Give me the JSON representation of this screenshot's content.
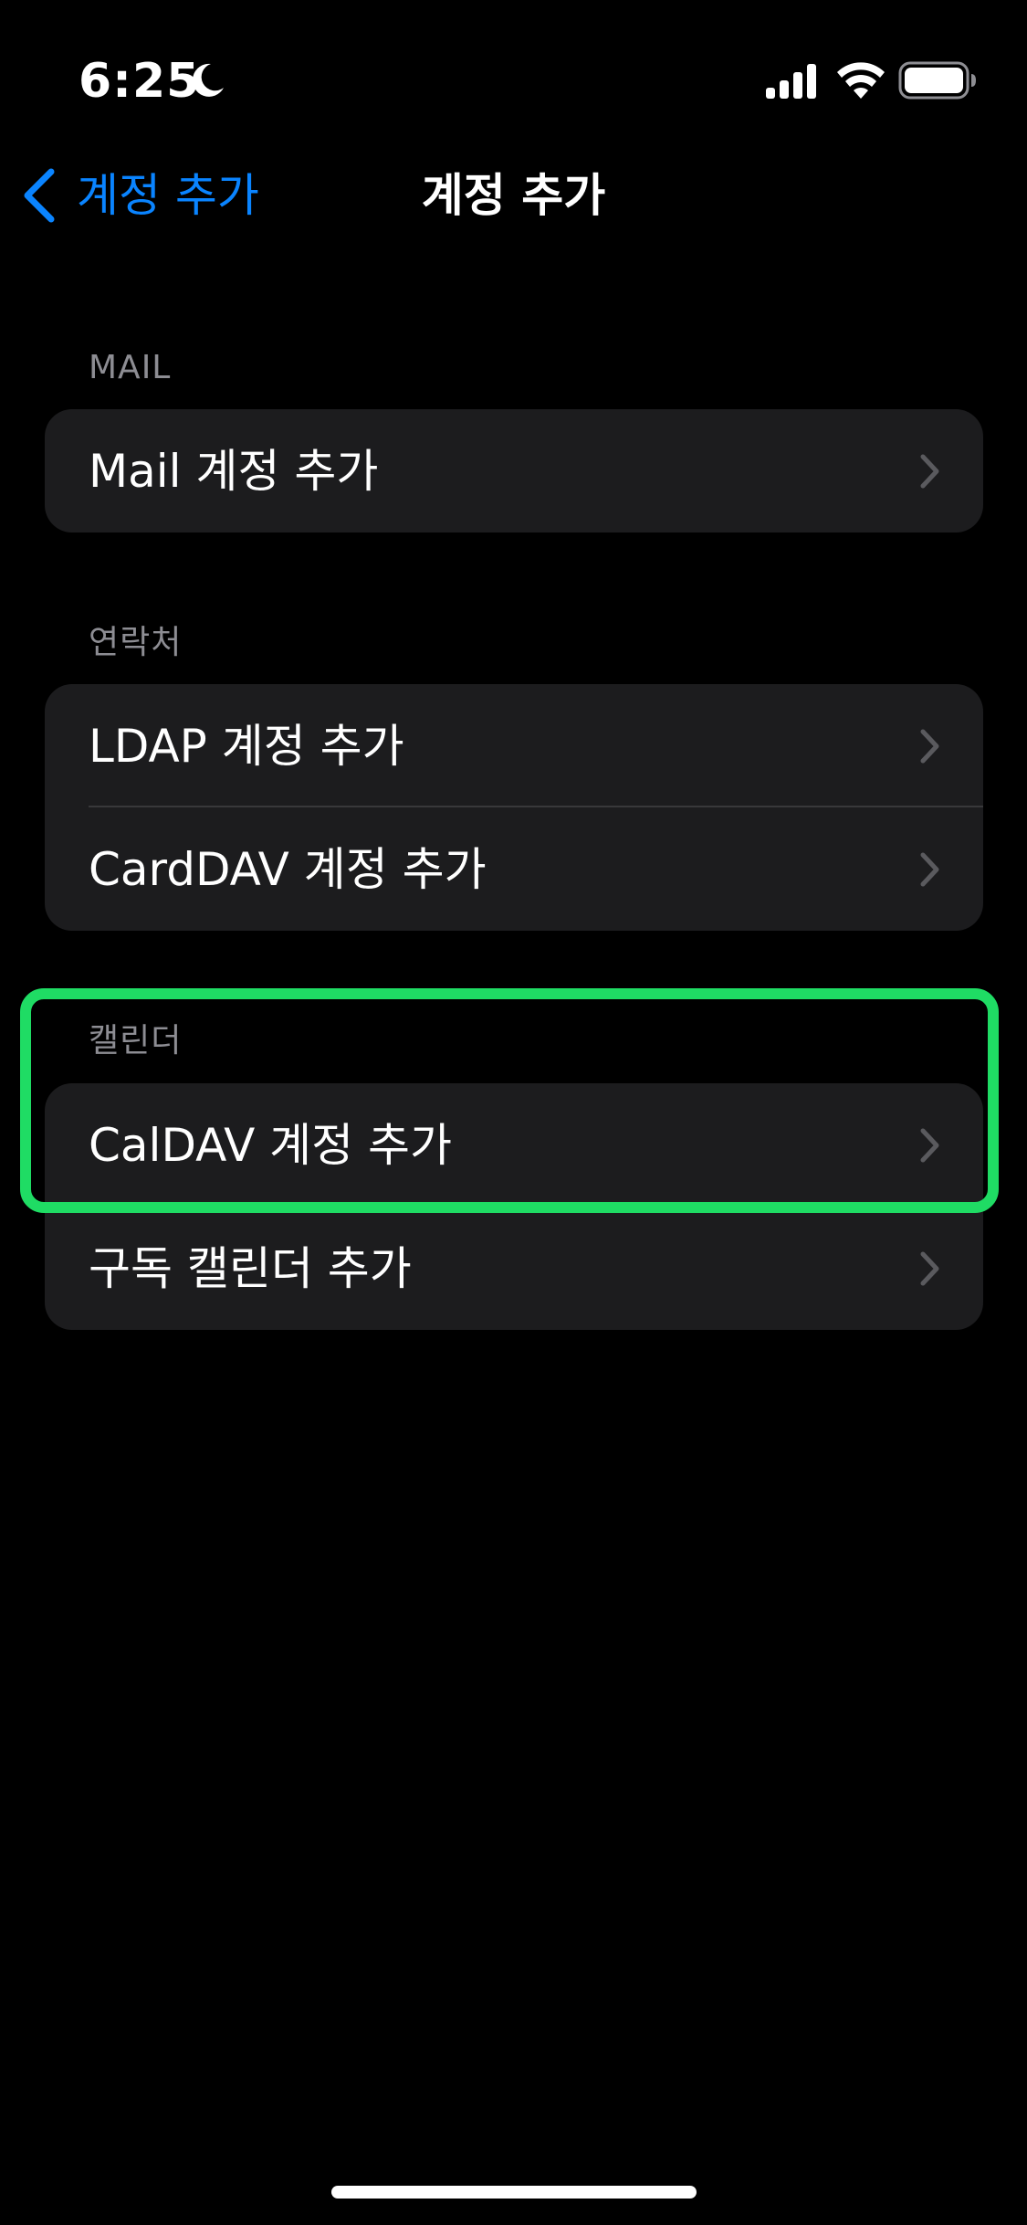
{
  "status_bar": {
    "time": "6:25",
    "icons": [
      "moon-icon",
      "cellular-signal-icon",
      "wifi-icon",
      "battery-icon"
    ]
  },
  "nav": {
    "back_label": "계정 추가",
    "title": "계정 추가"
  },
  "sections": {
    "mail": {
      "header": "MAIL",
      "rows": [
        "Mail 계정 추가"
      ]
    },
    "contacts": {
      "header": "연락처",
      "rows": [
        "LDAP 계정 추가",
        "CardDAV 계정 추가"
      ]
    },
    "calendar": {
      "header": "캘린더",
      "rows": [
        "CalDAV 계정 추가",
        "구독 캘린더 추가"
      ]
    }
  },
  "colors": {
    "background": "#000000",
    "cell": "#1c1c1e",
    "accent": "#0a84ff",
    "highlight": "#1fdc64",
    "secondary_text": "#8d8d93"
  }
}
